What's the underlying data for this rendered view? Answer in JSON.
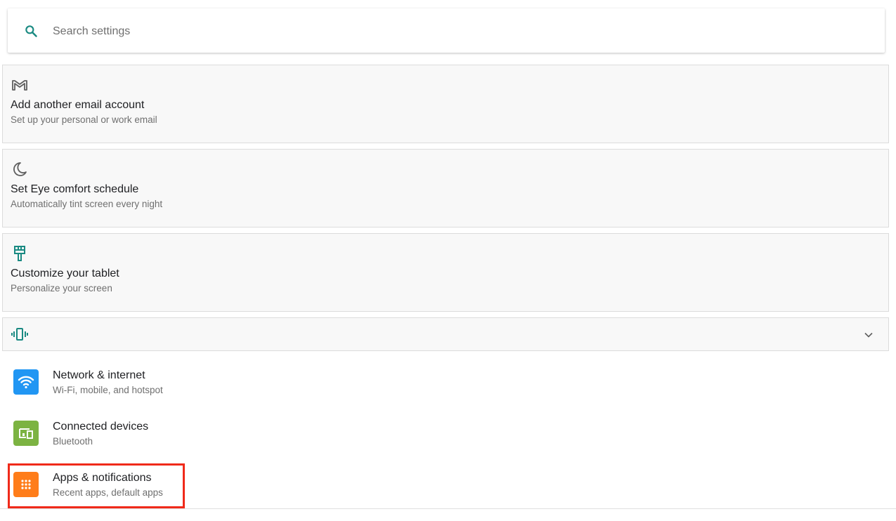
{
  "search": {
    "placeholder": "Search settings",
    "icon": "search-icon",
    "icon_color": "#1a8a82"
  },
  "suggestions": [
    {
      "icon": "gmail-icon",
      "title": "Add another email account",
      "subtitle": "Set up your personal or work email"
    },
    {
      "icon": "moon-icon",
      "title": "Set Eye comfort schedule",
      "subtitle": "Automatically tint screen every night"
    },
    {
      "icon": "paint-brush-icon",
      "title": "Customize your tablet",
      "subtitle": "Personalize your screen"
    }
  ],
  "collapsed_suggestion": {
    "icon": "vibrate-icon",
    "expand_icon": "chevron-down-icon"
  },
  "settings": [
    {
      "icon": "wifi-icon",
      "icon_bg": "#2196f3",
      "title": "Network & internet",
      "subtitle": "Wi-Fi, mobile, and hotspot"
    },
    {
      "icon": "devices-icon",
      "icon_bg": "#7cb342",
      "title": "Connected devices",
      "subtitle": "Bluetooth"
    },
    {
      "icon": "apps-grid-icon",
      "icon_bg": "#ff7d1a",
      "title": "Apps & notifications",
      "subtitle": "Recent apps, default apps"
    }
  ],
  "colors": {
    "accent": "#1a8a82",
    "highlight": "#f02a1a"
  }
}
